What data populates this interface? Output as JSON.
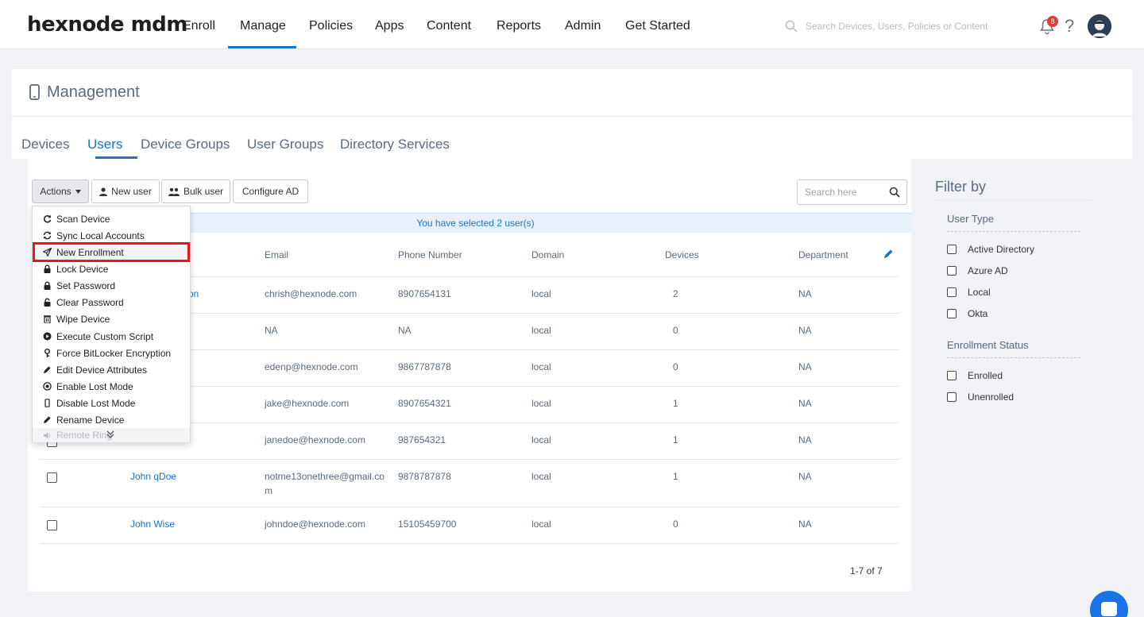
{
  "brand": {
    "logo": "hexnode mdm"
  },
  "nav": {
    "items": [
      "Enroll",
      "Manage",
      "Policies",
      "Apps",
      "Content",
      "Reports",
      "Admin",
      "Get Started"
    ],
    "active": "Manage"
  },
  "global_search": {
    "placeholder": "Search Devices, Users, Policies or Content"
  },
  "notifications": {
    "count": "8"
  },
  "page": {
    "title": "Management"
  },
  "tabs": [
    "Devices",
    "Users",
    "Device Groups",
    "User Groups",
    "Directory Services"
  ],
  "active_tab": "Users",
  "toolbar": {
    "actions_label": "Actions",
    "new_user_label": "New user",
    "bulk_user_label": "Bulk user",
    "configure_ad_label": "Configure AD",
    "search_placeholder": "Search here"
  },
  "selection_text": "You have selected 2 user(s)",
  "table": {
    "headers": [
      "Email",
      "Phone Number",
      "Domain",
      "Devices",
      "Department"
    ],
    "rows": [
      {
        "name": "on",
        "email": "chrish@hexnode.com",
        "phone": "8907654131",
        "domain": "local",
        "devices": "2",
        "department": "NA"
      },
      {
        "name": "",
        "email": "NA",
        "phone": "NA",
        "domain": "local",
        "devices": "0",
        "department": "NA"
      },
      {
        "name": "",
        "email": "edenp@hexnode.com",
        "phone": "9867787878",
        "domain": "local",
        "devices": "0",
        "department": "NA"
      },
      {
        "name": "",
        "email": "jake@hexnode.com",
        "phone": "8907654321",
        "domain": "local",
        "devices": "1",
        "department": "NA"
      },
      {
        "name": "",
        "email": "janedoe@hexnode.com",
        "phone": "987654321",
        "domain": "local",
        "devices": "1",
        "department": "NA"
      },
      {
        "name": "John qDoe",
        "email": "notme13onethree@gmail.com",
        "phone": "9878787878",
        "domain": "local",
        "devices": "1",
        "department": "NA"
      },
      {
        "name": "John Wise",
        "email": "johndoe@hexnode.com",
        "phone": "15105459700",
        "domain": "local",
        "devices": "0",
        "department": "NA"
      }
    ]
  },
  "pagination": "1-7 of 7",
  "actions_menu": [
    {
      "label": "Scan Device",
      "icon": "refresh-icon"
    },
    {
      "label": "Sync Local Accounts",
      "icon": "sync-icon"
    },
    {
      "label": "New Enrollment",
      "icon": "paper-plane-icon"
    },
    {
      "label": "Lock Device",
      "icon": "lock-icon"
    },
    {
      "label": "Set Password",
      "icon": "lock-icon"
    },
    {
      "label": "Clear Password",
      "icon": "unlock-icon"
    },
    {
      "label": "Wipe Device",
      "icon": "trash-icon"
    },
    {
      "label": "Execute Custom Script",
      "icon": "play-icon"
    },
    {
      "label": "Force BitLocker Encryption",
      "icon": "key-icon"
    },
    {
      "label": "Edit Device Attributes",
      "icon": "pencil-icon"
    },
    {
      "label": "Enable Lost Mode",
      "icon": "target-icon"
    },
    {
      "label": "Disable Lost Mode",
      "icon": "phone-icon"
    },
    {
      "label": "Rename Device",
      "icon": "pencil-icon"
    },
    {
      "label": "Remote Ring",
      "icon": "speaker-icon"
    }
  ],
  "filter": {
    "title": "Filter by",
    "user_type_label": "User Type",
    "user_types": [
      "Active Directory",
      "Azure AD",
      "Local",
      "Okta"
    ],
    "enrollment_status_label": "Enrollment Status",
    "enrollment_statuses": [
      "Enrolled",
      "Unenrolled"
    ]
  },
  "colors": {
    "accent": "#1a73c9",
    "highlight_border": "#e8171b",
    "badge": "#e23a3a"
  }
}
